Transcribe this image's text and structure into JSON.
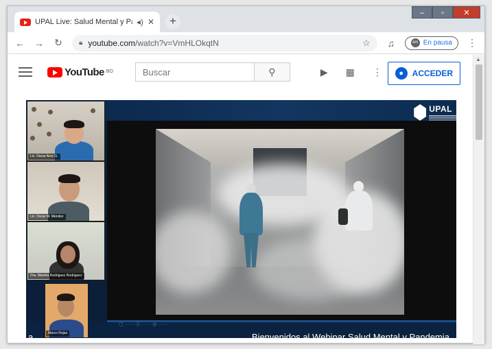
{
  "browser": {
    "tab_title": "UPAL Live: Salud Mental y Pa",
    "tab_audio_icon": "speaker-icon",
    "tab_close_icon": "close-icon",
    "new_tab": "+",
    "url_host": "youtube.com",
    "url_path": "/watch?v=VmHLOkqtN",
    "paused_label": "En pausa",
    "paused_avatar": "em"
  },
  "youtube": {
    "logo_text": "YouTube",
    "logo_country": "BO",
    "search_placeholder": "Buscar",
    "signin_label": "ACCEDER"
  },
  "video": {
    "brand": "UPAL",
    "caption": "Bienvenidos al Webinar Salud Mental y Pandemia",
    "caption_left": "a",
    "participants": [
      {
        "name": "Lic. Oscar Arce G."
      },
      {
        "name": "Lic. Oscar M. Mendez"
      },
      {
        "name": "Dra. Mariela Rodriguez Rodriguez"
      },
      {
        "name": "Marco Rojas"
      }
    ]
  },
  "colors": {
    "youtube_red": "#ff0000",
    "link_blue": "#065fd4",
    "video_frame": "#0b1f3a"
  }
}
